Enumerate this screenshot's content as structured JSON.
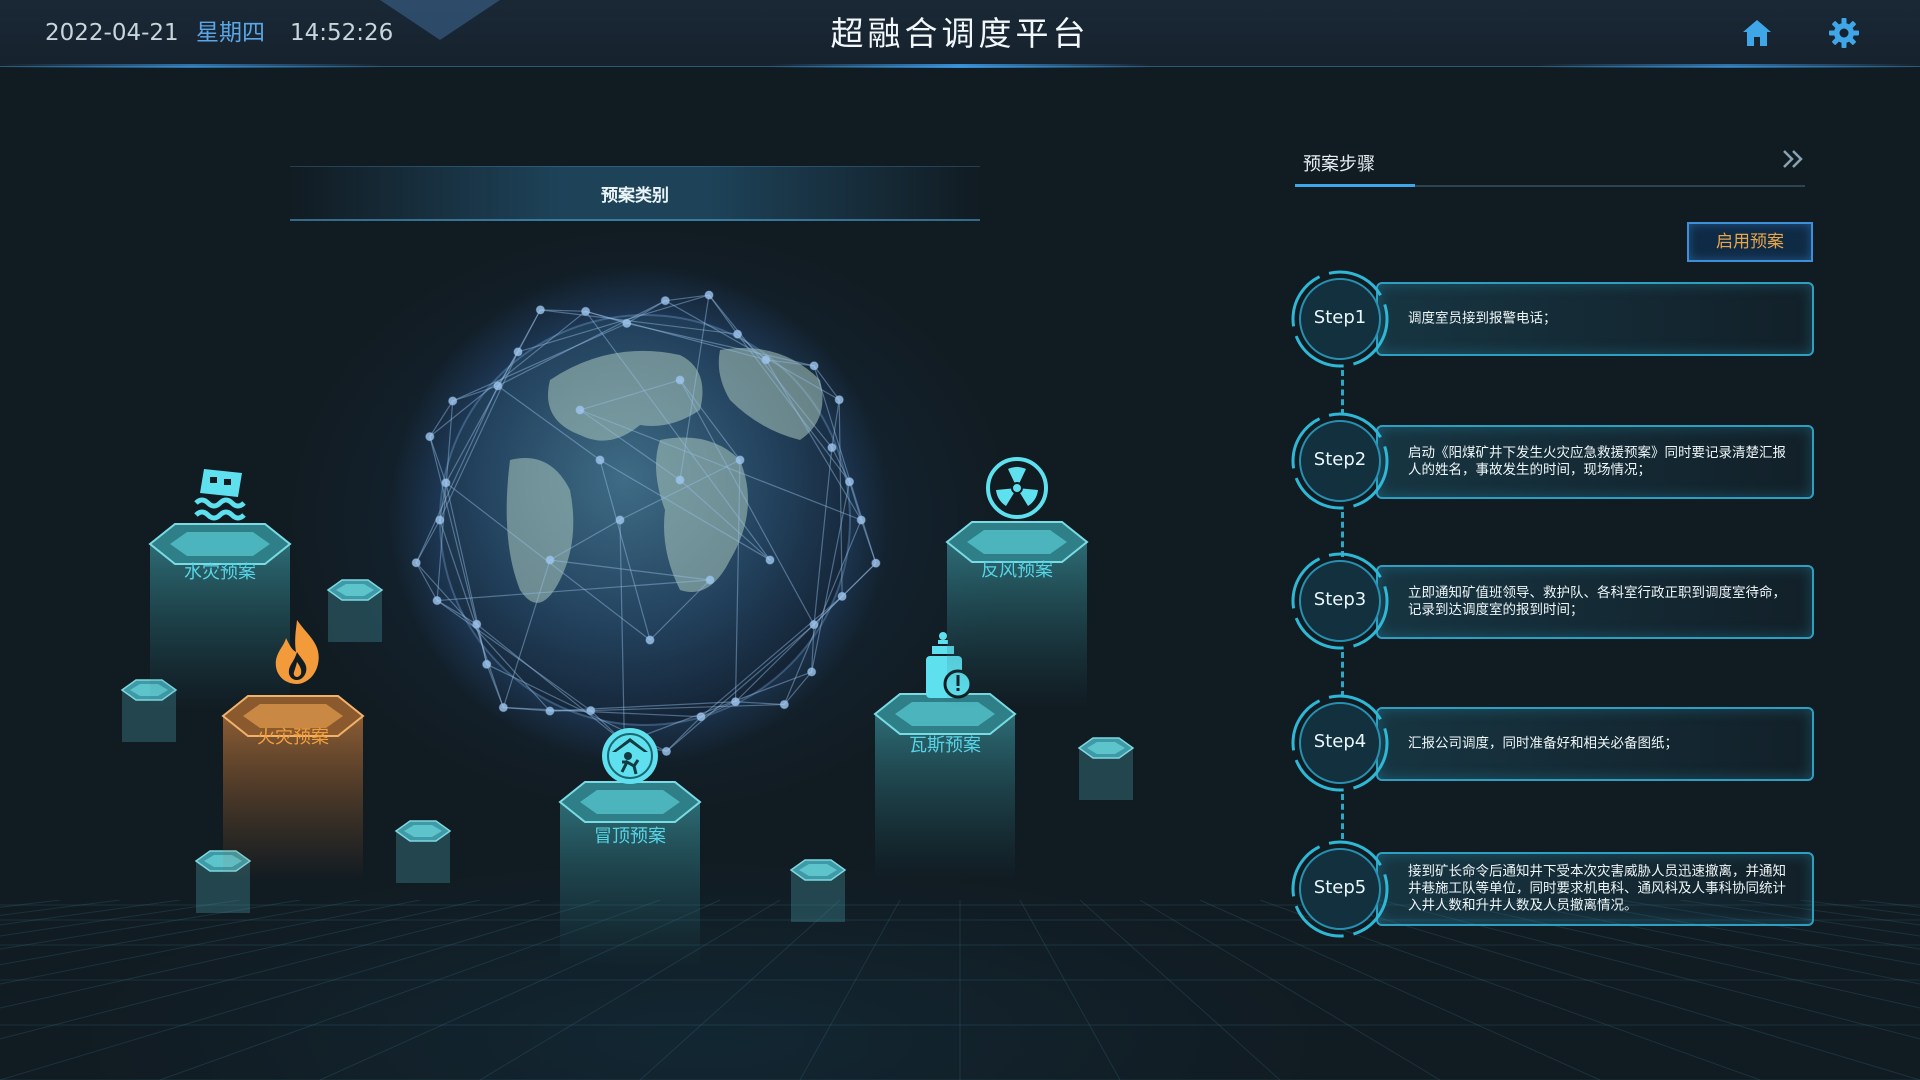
{
  "header": {
    "date": "2022-04-21",
    "weekday": "星期四",
    "time": "14:52:26",
    "title": "超融合调度平台",
    "icons": [
      "home-icon",
      "settings-icon"
    ]
  },
  "plan_categories": {
    "title": "预案类别",
    "items": [
      {
        "label": "水灾预案",
        "icon": "flood-icon",
        "color": "#57d4e6"
      },
      {
        "label": "火灾预案",
        "icon": "fire-icon",
        "color": "#f2a03c"
      },
      {
        "label": "冒顶预案",
        "icon": "roof-collapse-icon",
        "color": "#57d4e6"
      },
      {
        "label": "瓦斯预案",
        "icon": "gas-icon",
        "color": "#57d4e6"
      },
      {
        "label": "反风预案",
        "icon": "fan-icon",
        "color": "#57d4e6"
      }
    ]
  },
  "steps_panel": {
    "title": "预案步骤",
    "enable_button": "启用预案",
    "steps": [
      {
        "label": "Step1",
        "text": "调度室员接到报警电话；"
      },
      {
        "label": "Step2",
        "text": "启动《阳煤矿井下发生火灾应急救援预案》同时要记录清楚汇报人的姓名，事故发生的时间，现场情况；"
      },
      {
        "label": "Step3",
        "text": "立即通知矿值班领导、救护队、各科室行政正职到调度室待命，记录到达调度室的报到时间；"
      },
      {
        "label": "Step4",
        "text": "汇报公司调度，同时准备好和相关必备图纸；"
      },
      {
        "label": "Step5",
        "text": "接到矿长命令后通知井下受本次灾害威胁人员迅速撤离，并通知井巷施工队等单位，同时要求机电科、通风科及人事科协同统计入井人数和升井人数及人员撤离情况。"
      }
    ]
  },
  "colors": {
    "background": "#111b22",
    "accent_blue": "#3fa6e8",
    "teal": "#2f9fc1",
    "fire_orange": "#f2a03c",
    "enable_text": "#e8a54a"
  }
}
